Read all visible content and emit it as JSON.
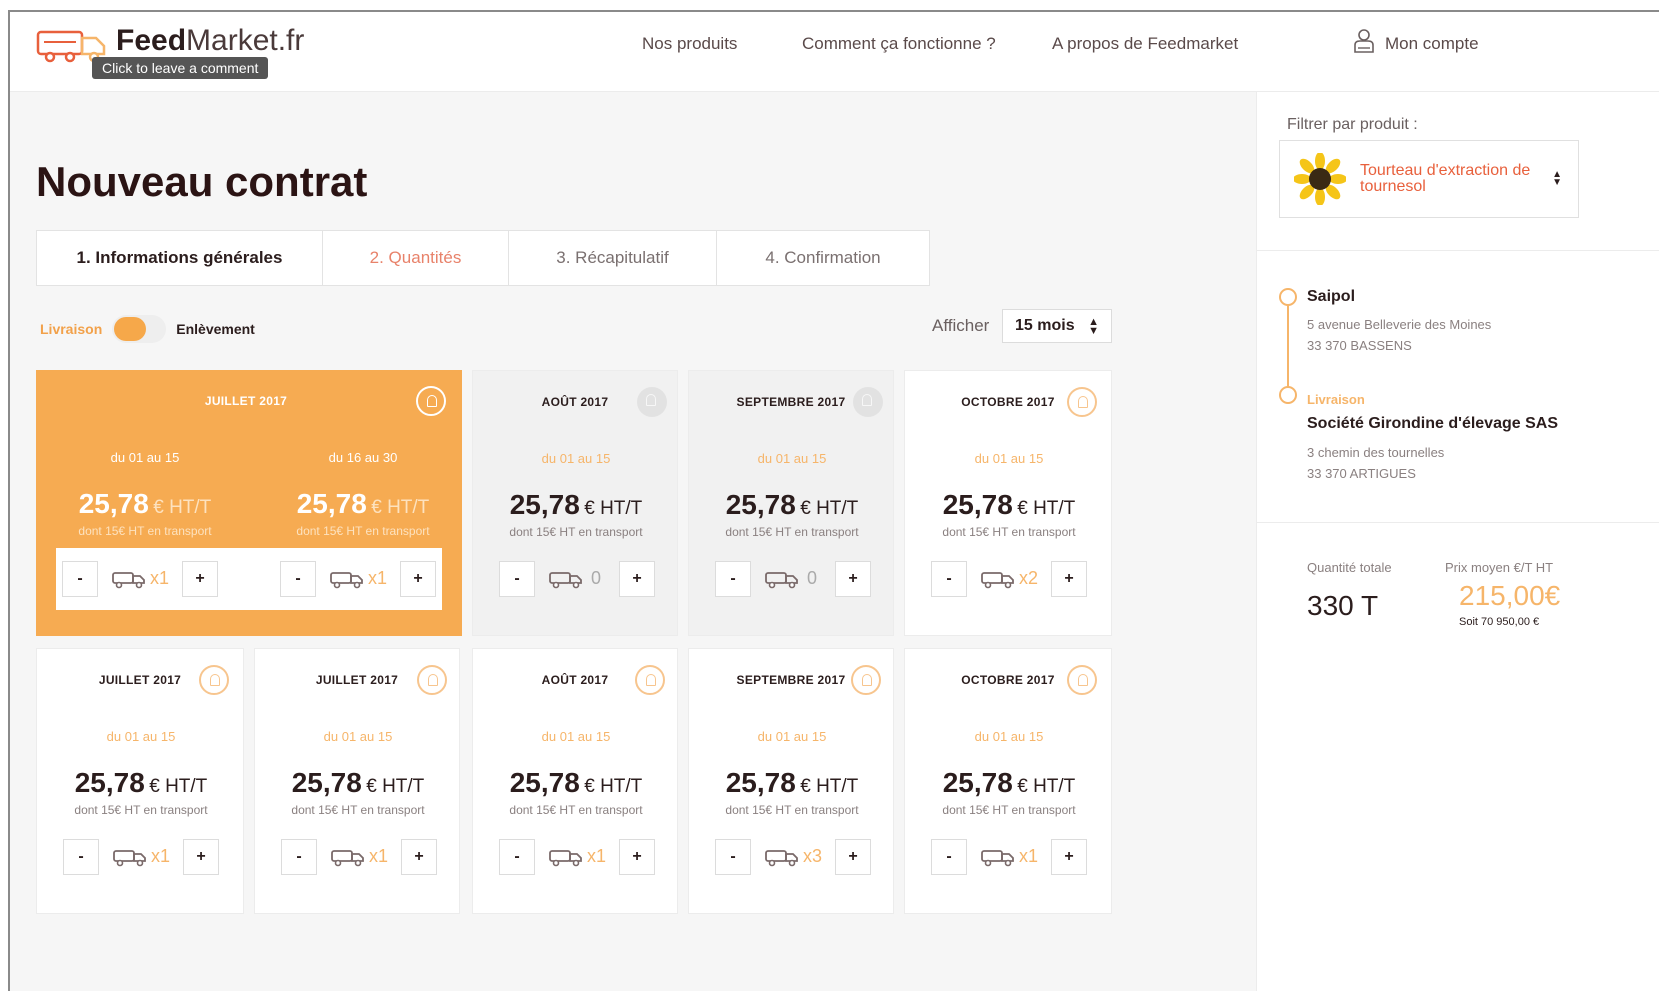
{
  "header": {
    "logo_bold": "Feed",
    "logo_light": "Market.fr",
    "tooltip": "Click to leave a comment",
    "nav": [
      "Nos produits",
      "Comment ça fonctionne ?",
      "A propos de Feedmarket"
    ],
    "account_label": "Mon compte"
  },
  "main": {
    "title": "Nouveau contrat",
    "tabs": [
      "1. Informations générales",
      "2. Quantités",
      "3. Récapitulatif",
      "4. Confirmation"
    ],
    "active_tab": "2. Quantités",
    "toggle": {
      "left_label": "Livraison",
      "right_label": "Enlèvement",
      "selected": "Livraison"
    },
    "afficher_label": "Afficher",
    "months_select": "15 mois"
  },
  "cards": {
    "big": {
      "month": "JUILLET 2017",
      "halves": [
        {
          "period": "du 01 au 15",
          "price": "25,78",
          "unit": "€ HT/T",
          "transport": "dont 15€ HT en transport",
          "qty": "x1"
        },
        {
          "period": "du 16 au 30",
          "price": "25,78",
          "unit": "€ HT/T",
          "transport": "dont 15€ HT en transport",
          "qty": "x1"
        }
      ]
    },
    "row1": [
      {
        "month": "AOÛT 2017",
        "period": "du 01 au 15",
        "price": "25,78",
        "unit": "€ HT/T",
        "transport": "dont 15€ HT en transport",
        "qty": "0"
      },
      {
        "month": "SEPTEMBRE 2017",
        "period": "du 01 au 15",
        "price": "25,78",
        "unit": "€ HT/T",
        "transport": "dont 15€ HT en transport",
        "qty": "0"
      },
      {
        "month": "OCTOBRE 2017",
        "period": "du 01 au 15",
        "price": "25,78",
        "unit": "€ HT/T",
        "transport": "dont 15€ HT en transport",
        "qty": "x2"
      }
    ],
    "row2": [
      {
        "month": "JUILLET 2017",
        "period": "du 01 au 15",
        "price": "25,78",
        "unit": "€ HT/T",
        "transport": "dont 15€ HT en transport",
        "qty": "x1"
      },
      {
        "month": "JUILLET 2017",
        "period": "du 01 au 15",
        "price": "25,78",
        "unit": "€ HT/T",
        "transport": "dont 15€ HT en transport",
        "qty": "x1"
      },
      {
        "month": "AOÛT 2017",
        "period": "du 01 au 15",
        "price": "25,78",
        "unit": "€ HT/T",
        "transport": "dont 15€ HT en transport",
        "qty": "x1"
      },
      {
        "month": "SEPTEMBRE 2017",
        "period": "du 01 au 15",
        "price": "25,78",
        "unit": "€ HT/T",
        "transport": "dont 15€ HT en transport",
        "qty": "x3"
      },
      {
        "month": "OCTOBRE 2017",
        "period": "du 01 au 15",
        "price": "25,78",
        "unit": "€ HT/T",
        "transport": "dont 15€ HT en transport",
        "qty": "x1"
      }
    ],
    "minus": "-",
    "plus": "+"
  },
  "sidebar": {
    "filter_label": "Filtrer par produit :",
    "product": "Tourteau d'extraction de tournesol",
    "origin": {
      "name": "Saipol",
      "addr1": "5 avenue Belleverie des Moines",
      "addr2": "33 370 BASSENS"
    },
    "destination": {
      "label": "Livraison",
      "name": "Société Girondine d'élevage SAS",
      "addr1": "3 chemin des tournelles",
      "addr2": "33 370 ARTIGUES"
    },
    "stats": {
      "qty_label": "Quantité totale",
      "qty_value": "330 T",
      "price_label": "Prix moyen €/T HT",
      "price_value": "215,00€",
      "price_sub": "Soit 70 950,00 €"
    }
  },
  "colors": {
    "accent": "#f6ab52",
    "active_tab": "#e8826a",
    "product_red": "#e8603c"
  }
}
